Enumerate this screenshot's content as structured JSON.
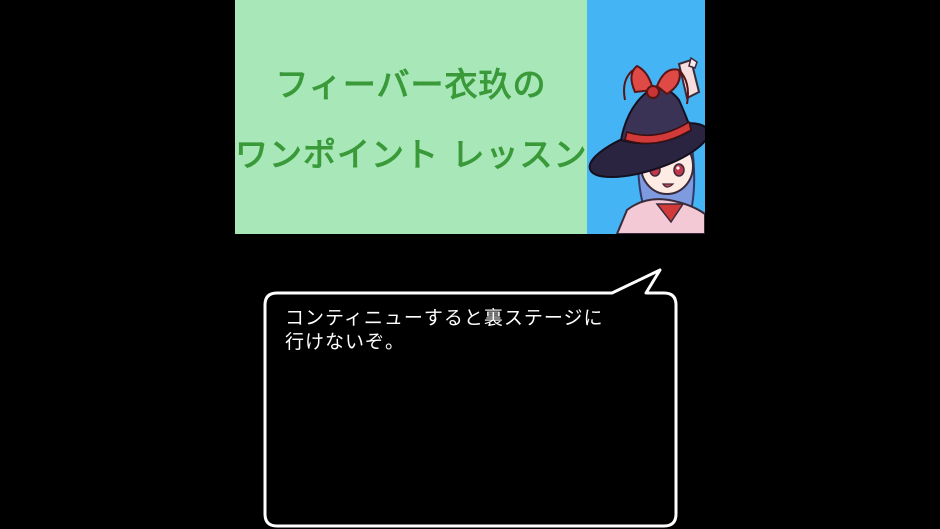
{
  "banner": {
    "title_line1": "フィーバー衣玖の",
    "title_line2": "ワンポイント レッスン",
    "title_color": "#3a9a3a",
    "panel_color": "#a8e8b8",
    "portrait_bg_color": "#44b4f4",
    "portrait_icon": "witch-character-portrait"
  },
  "dialog": {
    "line1": "コンティニューすると裏ステージに",
    "line2": "行けないぞ。",
    "border_color": "#ffffff",
    "background_color": "#000000"
  }
}
